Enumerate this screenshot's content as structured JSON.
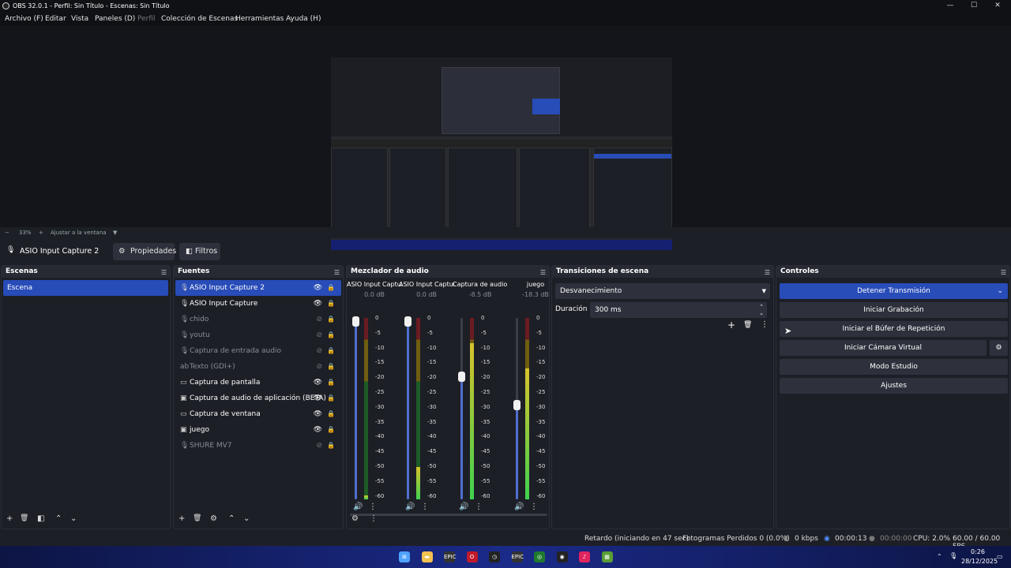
{
  "window": {
    "title": "OBS 32.0.1 - Perfil: Sin Título - Escenas: Sin Título",
    "min": "—",
    "max": "☐",
    "close": "✕"
  },
  "menu": [
    "Archivo (F)",
    "Editar",
    "Vista",
    "Paneles (D)",
    "Perfil",
    "Colección de Escenas",
    "Herramientas",
    "Ayuda (H)"
  ],
  "zoom": {
    "minus": "−",
    "value": "33%",
    "plus": "+",
    "fit": "Ajustar a la ventana",
    "arrow": "▼"
  },
  "source_toolbar": {
    "source_name": "ASIO Input Capture 2",
    "properties": "Propiedades",
    "filters": "Filtros"
  },
  "scenes": {
    "title": "Escenas",
    "items": [
      "Escena"
    ]
  },
  "sources": {
    "title": "Fuentes",
    "items": [
      {
        "label": "ASIO Input Capture 2",
        "icon": "mic-icon",
        "glyph": "🎙",
        "visible": true
      },
      {
        "label": "ASIO Input Capture",
        "icon": "mic-icon",
        "glyph": "🎙",
        "visible": true
      },
      {
        "label": "chido",
        "icon": "mic-icon",
        "glyph": "🎙",
        "visible": false
      },
      {
        "label": "youtu",
        "icon": "mic-icon",
        "glyph": "🎙",
        "visible": false
      },
      {
        "label": "Captura de entrada audio",
        "icon": "mic-icon",
        "glyph": "🎙",
        "visible": false
      },
      {
        "label": "Texto (GDI+)",
        "icon": "text-icon",
        "glyph": "ab",
        "visible": false
      },
      {
        "label": "Captura de pantalla",
        "icon": "monitor-icon",
        "glyph": "▭",
        "visible": true
      },
      {
        "label": "Captura de audio de aplicación (BETA)",
        "icon": "app-audio-icon",
        "glyph": "▣",
        "visible": true
      },
      {
        "label": "Captura de ventana",
        "icon": "window-icon",
        "glyph": "▭",
        "visible": true
      },
      {
        "label": "juego",
        "icon": "game-capture-icon",
        "glyph": "▣",
        "visible": true
      },
      {
        "label": "SHURE MV7",
        "icon": "mic-icon",
        "glyph": "🎙",
        "visible": false
      }
    ]
  },
  "mixer": {
    "title": "Mezclador de audio",
    "scale": [
      "0",
      "-5",
      "-10",
      "-15",
      "-20",
      "-25",
      "-30",
      "-35",
      "-40",
      "-45",
      "-50",
      "-55",
      "-60"
    ],
    "channels": [
      {
        "name": "ASIO Input Capture",
        "db": "0.0 dB",
        "fader": 1.0,
        "level": 0.02
      },
      {
        "name": "ASIO Input Capture",
        "db": "0.0 dB",
        "fader": 1.0,
        "level": 0.18
      },
      {
        "name": "Captura de audio c",
        "db": "-8.5 dB",
        "fader": 0.68,
        "level": 0.86
      },
      {
        "name": "juego",
        "db": "-18.3 dB",
        "fader": 0.52,
        "level": 0.72
      }
    ]
  },
  "transitions": {
    "title": "Transiciones de escena",
    "selected": "Desvanecimiento",
    "duration_label": "Duración",
    "duration": "300 ms"
  },
  "controls": {
    "title": "Controles",
    "buttons": [
      "Detener Transmisión",
      "Iniciar Grabación",
      "Iniciar el Búfer de Repetición",
      "Iniciar Cámara Virtual",
      "Modo Estudio",
      "Ajustes"
    ]
  },
  "status": {
    "delay": "Retardo (iniciando en 47 sec)",
    "dropped": "Fotogramas Perdidos 0 (0.0%)",
    "kbps": "0 kbps",
    "stream_time": "00:00:13",
    "rec_time": "00:00:00",
    "cpu": "CPU: 2.0%",
    "fps": "60.00 / 60.00 FPS"
  },
  "taskbar": {
    "time": "0:26",
    "date": "28/12/2025",
    "apps": [
      {
        "icon": "windows-start-icon",
        "glyph": "⊞",
        "color": "#4fa3ff"
      },
      {
        "icon": "file-explorer-icon",
        "glyph": "▬",
        "color": "#f2c14e"
      },
      {
        "icon": "epic-games-icon",
        "glyph": "EPIC",
        "color": "#333"
      },
      {
        "icon": "opera-icon",
        "glyph": "O",
        "color": "#c01a2a"
      },
      {
        "icon": "clock-icon",
        "glyph": "◷",
        "color": "#222"
      },
      {
        "icon": "epic-games-icon",
        "glyph": "EPIC",
        "color": "#333"
      },
      {
        "icon": "xbox-icon",
        "glyph": "◎",
        "color": "#1f7a2e"
      },
      {
        "icon": "obs-icon",
        "glyph": "◉",
        "color": "#222"
      },
      {
        "icon": "music-icon",
        "glyph": "♪",
        "color": "#e0245e"
      },
      {
        "icon": "minecraft-icon",
        "glyph": "▦",
        "color": "#5a9e34"
      }
    ]
  }
}
